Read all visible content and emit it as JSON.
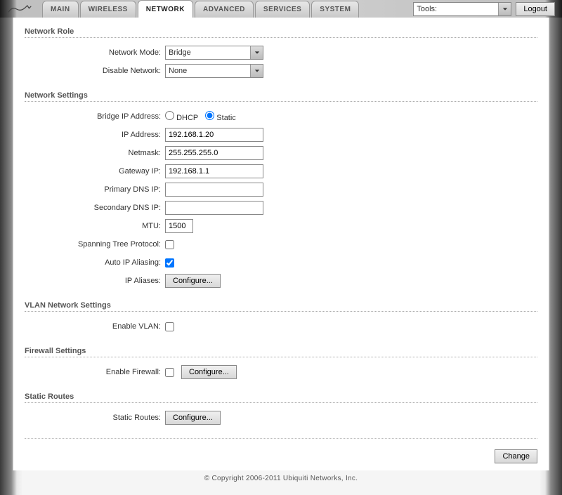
{
  "topbar": {
    "tabs": [
      "MAIN",
      "WIRELESS",
      "NETWORK",
      "ADVANCED",
      "SERVICES",
      "SYSTEM"
    ],
    "active_tab": 2,
    "tools_label": "Tools:",
    "logout": "Logout"
  },
  "sections": {
    "network_role": {
      "title": "Network Role",
      "network_mode_label": "Network Mode:",
      "network_mode_value": "Bridge",
      "disable_network_label": "Disable Network:",
      "disable_network_value": "None"
    },
    "network_settings": {
      "title": "Network Settings",
      "bridge_ip_label": "Bridge IP Address:",
      "radio_dhcp": "DHCP",
      "radio_static": "Static",
      "radio_selected": "static",
      "ip_label": "IP Address:",
      "ip_value": "192.168.1.20",
      "netmask_label": "Netmask:",
      "netmask_value": "255.255.255.0",
      "gateway_label": "Gateway IP:",
      "gateway_value": "192.168.1.1",
      "pdns_label": "Primary DNS IP:",
      "pdns_value": "",
      "sdns_label": "Secondary DNS IP:",
      "sdns_value": "",
      "mtu_label": "MTU:",
      "mtu_value": "1500",
      "stp_label": "Spanning Tree Protocol:",
      "stp_checked": false,
      "autoip_label": "Auto IP Aliasing:",
      "autoip_checked": true,
      "aliases_label": "IP Aliases:",
      "configure": "Configure..."
    },
    "vlan": {
      "title": "VLAN Network Settings",
      "enable_vlan_label": "Enable VLAN:",
      "enable_vlan_checked": false
    },
    "firewall": {
      "title": "Firewall Settings",
      "enable_firewall_label": "Enable Firewall:",
      "enable_firewall_checked": false,
      "configure": "Configure..."
    },
    "static_routes": {
      "title": "Static Routes",
      "label": "Static Routes:",
      "configure": "Configure..."
    }
  },
  "change_button": "Change",
  "copyright": "© Copyright 2006-2011 Ubiquiti Networks, Inc."
}
